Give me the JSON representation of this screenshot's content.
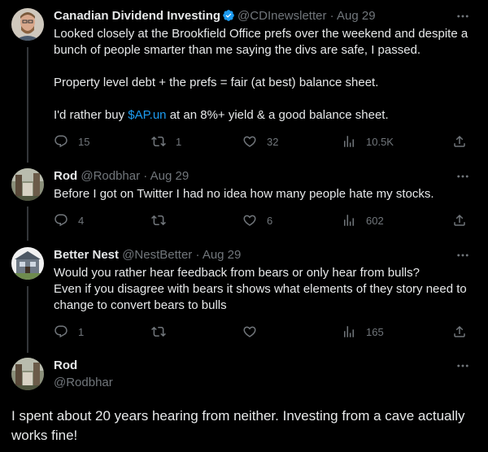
{
  "tweets": [
    {
      "name": "Canadian Dividend Investing",
      "verified": true,
      "handle": "@CDInewsletter",
      "date": "Aug 29",
      "paragraphs": [
        "Looked closely at the Brookfield Office prefs over the weekend and despite a bunch of people smarter than me saying the divs are safe, I passed.",
        "Property level debt + the prefs = fair (at best) balance sheet."
      ],
      "p3_before": "I'd rather buy ",
      "p3_link": "$AP.un",
      "p3_after": " at an 8%+ yield & a good balance sheet.",
      "replies": "15",
      "retweets": "1",
      "likes": "32",
      "views": "10.5K"
    },
    {
      "name": "Rod",
      "handle": "@Rodbhar",
      "date": "Aug 29",
      "text": "Before I got on Twitter I had no idea how many people hate my stocks.",
      "replies": "4",
      "retweets": "",
      "likes": "6",
      "views": "602"
    },
    {
      "name": "Better Nest",
      "handle": "@NestBetter",
      "date": "Aug 29",
      "line1": "Would you rather hear feedback from bears or only hear from bulls?",
      "line2": "Even if you disagree with bears it shows what elements of they story need to change to convert bears to bulls",
      "replies": "1",
      "retweets": "",
      "likes": "",
      "views": "165"
    },
    {
      "name": "Rod",
      "handle": "@Rodbhar",
      "text": "I spent about 20 years hearing from neither. Investing from a cave actually works fine!"
    }
  ],
  "dot": "·",
  "icons": {
    "more": "more-icon",
    "reply": "reply-icon",
    "retweet": "retweet-icon",
    "like": "like-icon",
    "views": "views-icon",
    "share": "share-icon",
    "verified": "verified-badge-icon"
  },
  "colors": {
    "background": "#000000",
    "text": "#e7e9ea",
    "muted": "#71767b",
    "link": "#1d9bf0",
    "verified": "#1d9bf0",
    "thread_line": "#333639"
  }
}
